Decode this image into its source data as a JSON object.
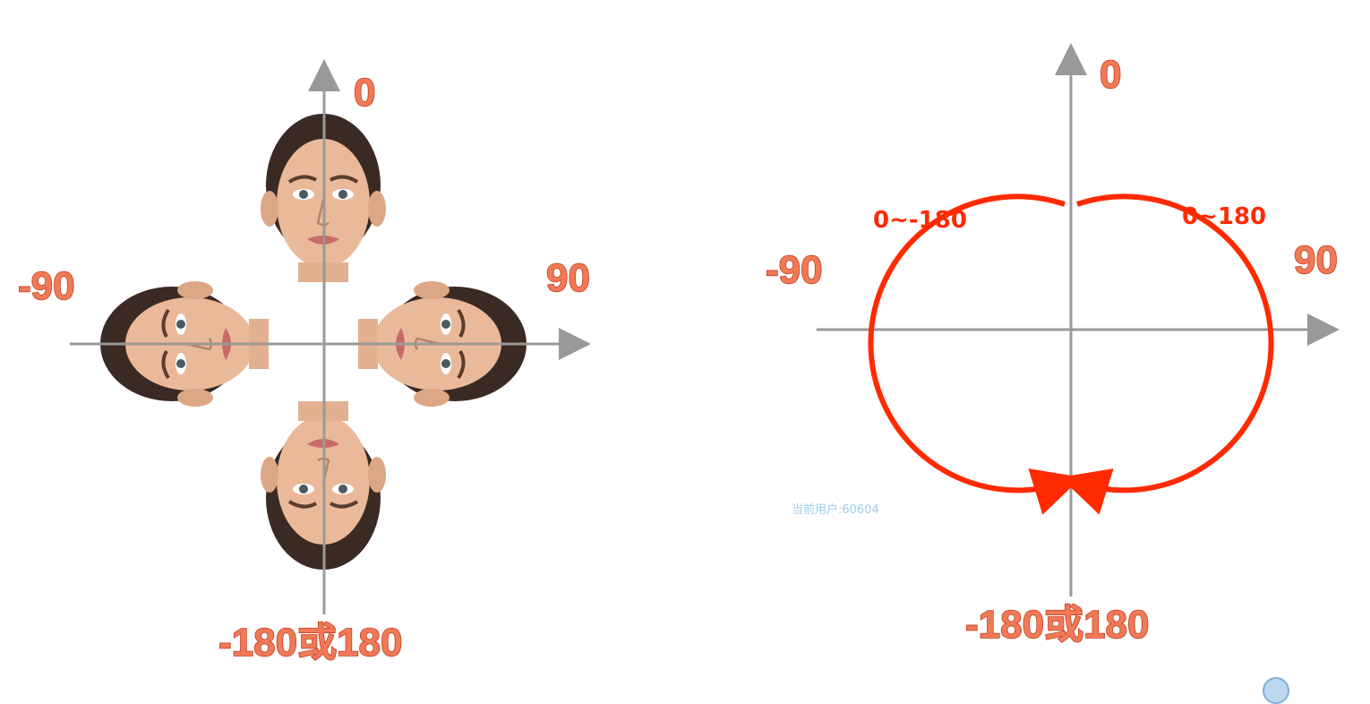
{
  "left": {
    "labels": {
      "top": "0",
      "right": "90",
      "left": "-90",
      "bottom": "-180或180"
    }
  },
  "right": {
    "labels": {
      "top": "0",
      "right": "90",
      "left": "-90",
      "bottom": "-180或180"
    },
    "ranges": {
      "right": "0~180",
      "left": "0~-180"
    }
  },
  "watermark": "当前用户:60604",
  "colors": {
    "axis": "#999999",
    "label_fill": "#f07a57",
    "label_stroke": "#c23a1c",
    "arc": "#ff2a00"
  },
  "icons": [
    "face-top",
    "face-right",
    "face-left",
    "face-bottom",
    "corner-logo-icon"
  ]
}
